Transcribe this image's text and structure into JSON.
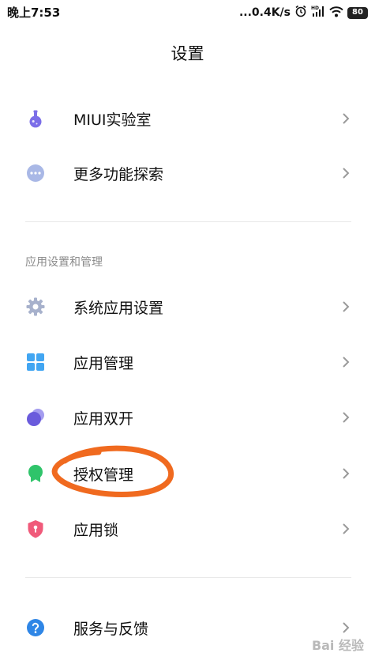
{
  "status_bar": {
    "time": "晚上7:53",
    "network_speed": "...0.4K/s",
    "battery": "80",
    "icons": [
      "alarm-icon",
      "hd-signal-icon",
      "wifi-icon",
      "battery-icon"
    ]
  },
  "header": {
    "title": "设置"
  },
  "top_group": [
    {
      "label": "MIUI实验室",
      "icon": "flask-icon"
    },
    {
      "label": "更多功能探索",
      "icon": "more-dots-icon"
    }
  ],
  "app_section": {
    "header": "应用设置和管理",
    "items": [
      {
        "label": "系统应用设置",
        "icon": "gear-icon"
      },
      {
        "label": "应用管理",
        "icon": "grid-icon"
      },
      {
        "label": "应用双开",
        "icon": "dual-circle-icon"
      },
      {
        "label": "授权管理",
        "icon": "badge-icon"
      },
      {
        "label": "应用锁",
        "icon": "shield-lock-icon"
      }
    ]
  },
  "bottom_group": [
    {
      "label": "服务与反馈",
      "icon": "help-icon"
    }
  ],
  "watermark": "Bai 经验",
  "colors": {
    "flask": "#7b6ee8",
    "more": "#a9b8e6",
    "gear": "#a7b1cc",
    "grid": "#42a6f2",
    "dual": "#6a5bdc",
    "badge": "#2fc46a",
    "shield": "#f05a7a",
    "help": "#2f86e6",
    "annotation": "#f06a1f"
  }
}
